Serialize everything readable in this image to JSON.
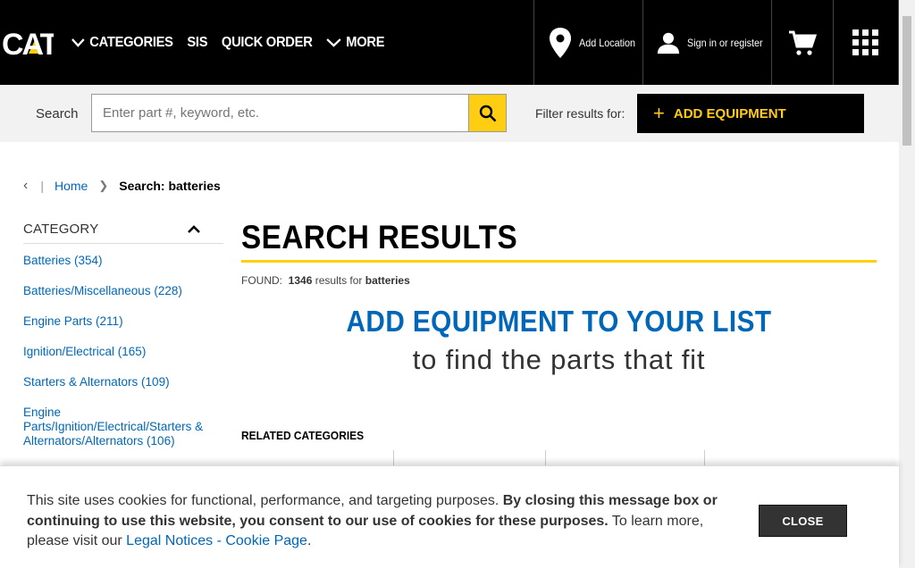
{
  "header": {
    "logo_text": "CAT",
    "nav": [
      "CATEGORIES",
      "SIS",
      "QUICK ORDER",
      "MORE"
    ],
    "add_location": "Add Location",
    "sign_in": "Sign in or register"
  },
  "search": {
    "label": "Search",
    "placeholder": "Enter part #, keyword, etc.",
    "filter_label": "Filter results for:",
    "add_equipment": "ADD EQUIPMENT"
  },
  "breadcrumb": {
    "home": "Home",
    "current": "Search: batteries"
  },
  "sidebar": {
    "heading": "CATEGORY",
    "items": [
      "Batteries (354)",
      "Batteries/Miscellaneous (228)",
      "Engine Parts (211)",
      "Ignition/Electrical (165)",
      "Starters & Alternators (109)",
      "Engine Parts/Ignition/Electrical/Starters & Alternators/Alternators (106)"
    ]
  },
  "main": {
    "title": "SEARCH RESULTS",
    "found_label": "FOUND:",
    "found_count": "1346",
    "found_mid": "results for",
    "found_query": "batteries",
    "promo_heading": "ADD EQUIPMENT TO YOUR LIST",
    "promo_sub": "to find the parts that fit",
    "related_heading": "RELATED CATEGORIES"
  },
  "cookie": {
    "text_1": "This site uses cookies for functional, performance, and targeting purposes. ",
    "text_bold": "By closing this message box or continuing to use this website, you consent to our use of cookies for these purposes.",
    "text_2": " To learn more, please visit our ",
    "link": "Legal Notices - Cookie Page",
    "text_3": ".",
    "close": "CLOSE"
  },
  "colors": {
    "brand_yellow": "#ffcd11",
    "header_bg": "#000000",
    "link_blue": "#0067b8"
  },
  "icons": [
    "cat-logo",
    "chevron-down-icon",
    "location-pin-icon",
    "user-icon",
    "cart-icon",
    "grid-icon",
    "search-icon",
    "plus-icon",
    "chevron-left-icon",
    "chevron-right-icon",
    "chevron-up-icon"
  ]
}
